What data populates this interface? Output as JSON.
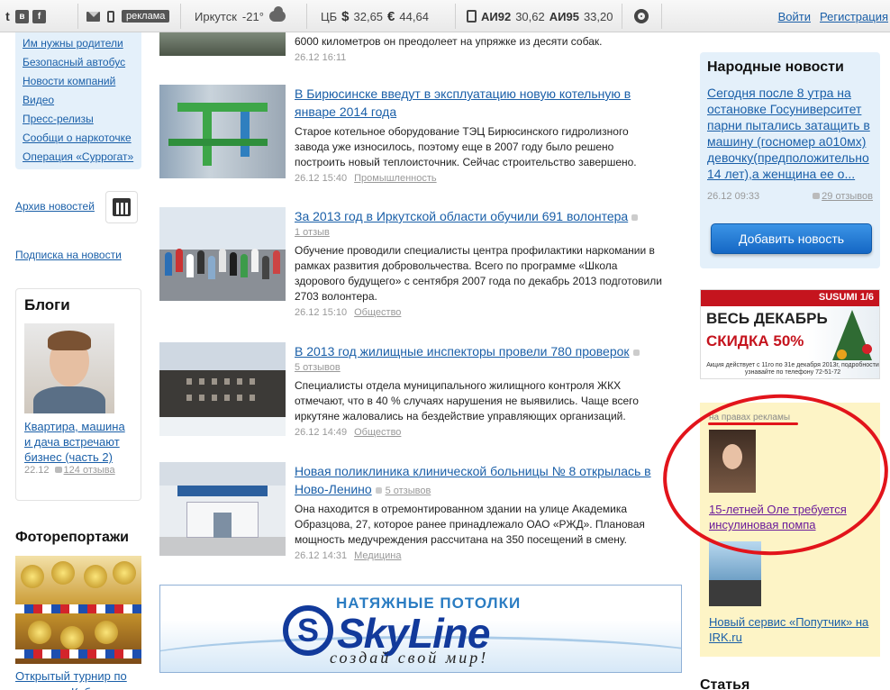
{
  "topbar": {
    "social": [
      "t",
      "в",
      "f"
    ],
    "ads_label": "реклама",
    "weather": {
      "city": "Иркутск",
      "temp": "-21°"
    },
    "rates": {
      "label": "ЦБ",
      "usd_symbol": "$",
      "usd": "32,65",
      "eur_symbol": "€",
      "eur": "44,64"
    },
    "fuel": {
      "a92_label": "АИ92",
      "a92": "30,62",
      "a95_label": "АИ95",
      "a95": "33,20"
    },
    "auth": {
      "login": "Войти",
      "register": "Регистрация"
    }
  },
  "left": {
    "links": [
      "Им нужны родители",
      "Безопасный автобус",
      "Новости компаний",
      "Видео",
      "Пресс-релизы",
      "Сообщи о наркоточке",
      "Операция «Суррогат»"
    ],
    "archive": "Архив новостей",
    "subscribe": "Подписка на новости",
    "blogs": {
      "title": "Блоги",
      "post_title": "Квартира, машина и дача встречают бизнес (часть 2)",
      "date": "22.12",
      "comments": "124 отзыва"
    },
    "photo": {
      "title": "Фоторепортажи",
      "link": "Открытый турнир по карате на Кубок"
    }
  },
  "news": {
    "top": {
      "text": "6000 километров он преодолеет на упряжке из десяти собак.",
      "meta": "26.12  16:11"
    },
    "items": [
      {
        "title": "В Бирюсинске введут в эксплуатацию новую котельную в январе 2014 года",
        "comments": "",
        "text": "Старое котельное оборудование ТЭЦ Бирюсинского гидролизного завода уже износилось, поэтому еще в 2007 году было решено построить новый теплоисточник. Сейчас строительство завершено.",
        "date": "26.12  15:40",
        "category": "Промышленность"
      },
      {
        "title": "За 2013 год в Иркутской области обучили 691 волонтера",
        "comments": "1 отзыв",
        "text": "Обучение проводили специалисты центра профилактики наркомании в рамках развития добровольчества. Всего по программе «Школа здорового будущего» с сентября 2007 года по декабрь 2013 подготовили 2703 волонтера.",
        "date": "26.12  15:10",
        "category": "Общество"
      },
      {
        "title": "В 2013 год жилищные инспекторы провели 780 проверок",
        "comments": "5 отзывов",
        "text": "Специалисты отдела муниципального жилищного контроля ЖКХ отмечают, что в 40 % случаях нарушения не выявились. Чаще всего иркутяне жаловались на бездействие управляющих организаций.",
        "date": "26.12  14:49",
        "category": "Общество"
      },
      {
        "title": "Новая поликлиника клинической больницы № 8 открылась в Ново-Ленино",
        "comments": "5 отзывов",
        "text": "Она находится в отремонтированном здании на улице Академика Образцова, 27, которое ранее принадлежало ОАО «РЖД». Плановая мощность медучреждения рассчитана на 350 посещений в смену.",
        "date": "26.12  14:31",
        "category": "Медицина"
      }
    ],
    "banner": {
      "top": "НАТЯЖНЫЕ ПОТОЛКИ",
      "name": "SkyLine",
      "logo": "S",
      "slogan": "создай свой мир!"
    }
  },
  "right": {
    "folk": {
      "title": "Народные новости",
      "link": "Сегодня после 8 утра на остановке Госуниверситет парни пытались затащить в машину (госномер а010мх) девочку(предположительно 14 лет),а женщина ее о...",
      "date": "26.12  09:33",
      "comments": "29 отзывов",
      "button": "Добавить новость"
    },
    "susumi": {
      "brand": "SUSUMI 1/6",
      "line1": "ВЕСЬ ДЕКАБРЬ",
      "line2": "СКИДКА 50%",
      "fine": "Акция действует с 11го по 31е декабря 2013г, подробности узнавайте по телефону 72-51-72"
    },
    "ad": {
      "label": "на правах рекламы",
      "link1": "15-летней Оле требуется инсулиновая помпа",
      "link2": "Новый сервис «Попутчик» на IRK.ru"
    },
    "statya": "Статья"
  }
}
